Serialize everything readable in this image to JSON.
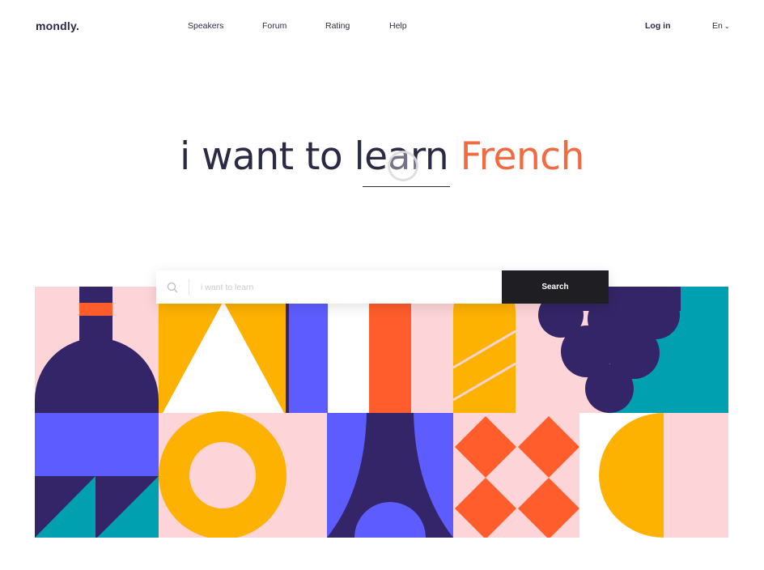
{
  "nav": {
    "logo": "mondly.",
    "links": [
      "Speakers",
      "Forum",
      "Rating",
      "Help"
    ],
    "login": "Log in",
    "language": "En"
  },
  "hero": {
    "prefix": "i want to learn",
    "language": "French"
  },
  "search": {
    "placeholder": "i want to learn",
    "button_label": "Search"
  },
  "colors": {
    "orange": "#f26a3f",
    "navy": "#332567",
    "pink": "#fdd5d8",
    "yellow": "#fdb100",
    "periwinkle": "#5d5cff",
    "teal": "#00a0b0",
    "dark_button": "#1f1f23"
  }
}
